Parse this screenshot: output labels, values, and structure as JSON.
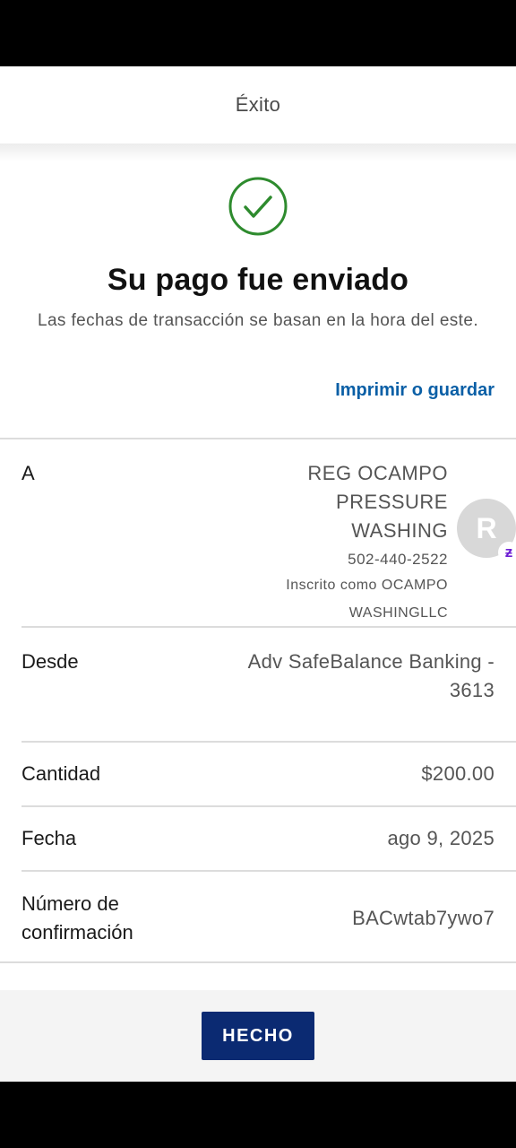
{
  "header": {
    "title": "Éxito"
  },
  "success": {
    "icon": "check-circle-icon",
    "icon_color": "#2e8b2e",
    "title": "Su pago fue enviado",
    "subtitle": "Las fechas de transacción se basan en la hora del este."
  },
  "print_link": "Imprimir o guardar",
  "details": {
    "to": {
      "label": "A",
      "name_line1": "REG OCAMPO",
      "name_line2": "PRESSURE",
      "name_line3": "WASHING",
      "phone": "502-440-2522",
      "enrolled_line1": "Inscrito como OCAMPO",
      "enrolled_line2": "WASHINGLLC",
      "avatar_letter": "R",
      "badge": "zelle-icon"
    },
    "from": {
      "label": "Desde",
      "value_line1": "Adv SafeBalance Banking -",
      "value_line2": "3613"
    },
    "amount": {
      "label": "Cantidad",
      "value": "$200.00"
    },
    "date": {
      "label": "Fecha",
      "value": "ago 9, 2025"
    },
    "confirmation": {
      "label_line1": "Número de",
      "label_line2": "confirmación",
      "value": "BACwtab7ywo7"
    }
  },
  "footer": {
    "done_label": "HECHO",
    "button_color": "#0b2a72"
  }
}
